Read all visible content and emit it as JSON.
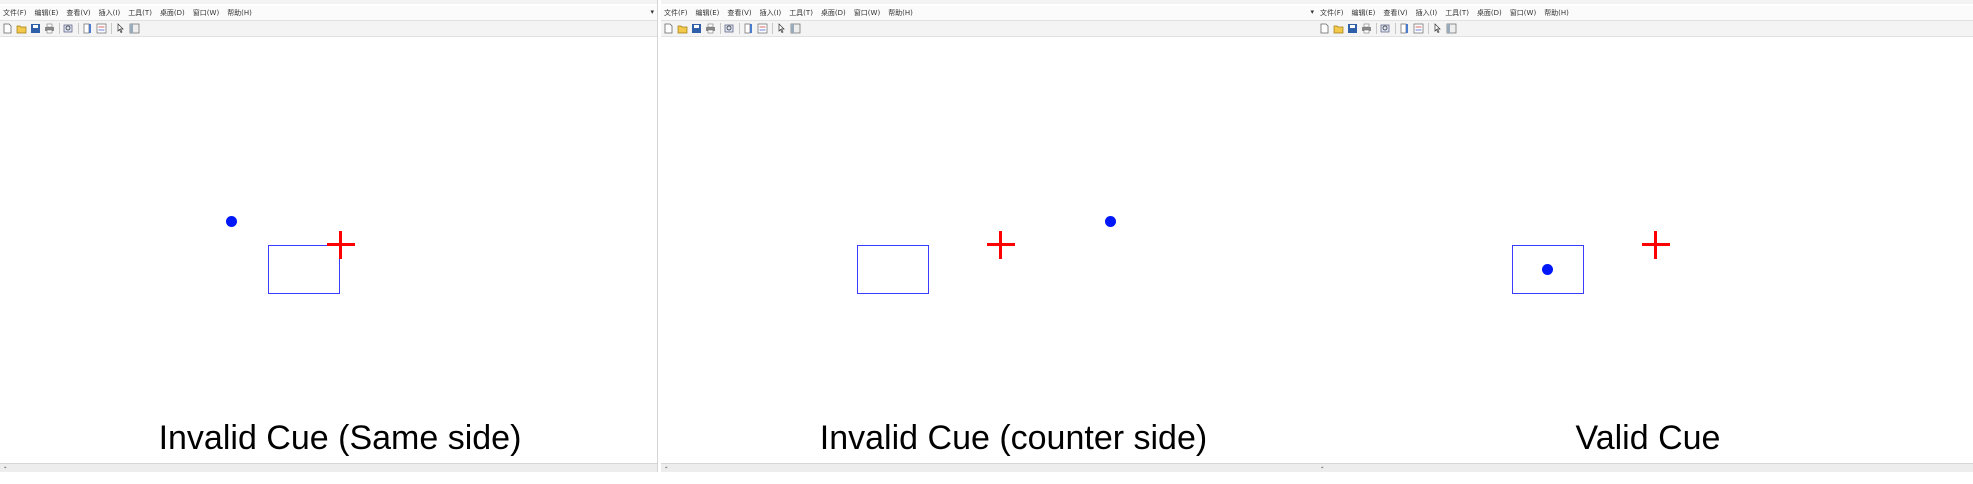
{
  "menu": [
    "文件(F)",
    "编辑(E)",
    "查看(V)",
    "插入(I)",
    "工具(T)",
    "桌面(D)",
    "窗口(W)",
    "帮助(H)"
  ],
  "toolbar_icons": [
    "new-file-icon",
    "open-folder-icon",
    "save-icon",
    "print-icon",
    "zoom-icon",
    "insert-colorbar-icon",
    "insert-legend-icon",
    "pointer-icon",
    "property-editor-icon"
  ],
  "panels": [
    {
      "caption": "Invalid Cue (Same side)"
    },
    {
      "caption": "Invalid Cue (counter side)"
    },
    {
      "caption": "Valid Cue"
    }
  ],
  "colors": {
    "cue_dot": "#0018f9",
    "target_box": "#3c3cff",
    "fixation_cross": "#ff0000"
  }
}
